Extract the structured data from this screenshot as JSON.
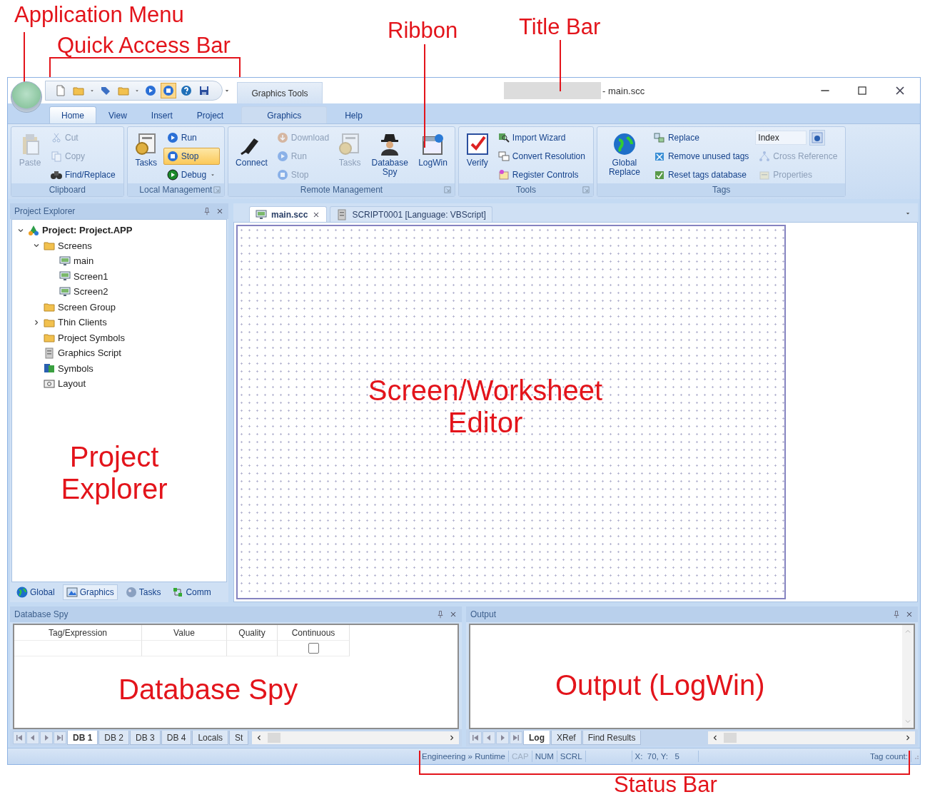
{
  "annotations": [
    "Application Menu",
    "Quick Access Bar",
    "Ribbon",
    "Title Bar",
    "Screen/Worksheet Editor",
    "Project Explorer",
    "Database Spy",
    "Output (LogWin)",
    "Status Bar"
  ],
  "quick_access_bar": {
    "items": [
      {
        "pressed": false
      },
      {
        "pressed": false
      },
      {
        "pressed": false
      },
      {
        "pressed": false
      },
      {
        "pressed": false
      },
      {
        "pressed": true
      },
      {
        "pressed": false
      },
      {
        "pressed": false
      }
    ]
  },
  "title_bar": {
    "contextual_header": "Graphics Tools",
    "title": "- main.scc"
  },
  "ribbon": {
    "tabs": [
      {
        "label": "Home",
        "selected": true,
        "contextual": false
      },
      {
        "label": "View",
        "selected": false,
        "contextual": false
      },
      {
        "label": "Insert",
        "selected": false,
        "contextual": false
      },
      {
        "label": "Project",
        "selected": false,
        "contextual": false
      },
      {
        "label": "Graphics",
        "selected": false,
        "contextual": true
      },
      {
        "label": "Help",
        "selected": false,
        "contextual": false
      }
    ],
    "groups": [
      {
        "label": "Clipboard",
        "launcher": false,
        "columns": [
          {
            "kind": "large",
            "items": [
              {
                "label": "Paste",
                "disabled": true,
                "active": false
              }
            ]
          },
          {
            "kind": "stack",
            "items": [
              {
                "label": "Cut",
                "disabled": true,
                "active": false
              },
              {
                "label": "Copy",
                "disabled": true,
                "active": false
              },
              {
                "label": "Find/Replace",
                "disabled": false,
                "active": false
              }
            ]
          }
        ]
      },
      {
        "label": "Local Management",
        "launcher": true,
        "columns": [
          {
            "kind": "large",
            "items": [
              {
                "label": "Tasks",
                "disabled": false,
                "active": false
              }
            ]
          },
          {
            "kind": "stack",
            "items": [
              {
                "label": "Run",
                "disabled": false,
                "active": false
              },
              {
                "label": "Stop",
                "disabled": false,
                "active": true
              },
              {
                "label": "Debug",
                "disabled": false,
                "active": false,
                "dropdown": true
              }
            ]
          }
        ]
      },
      {
        "label": "Remote Management",
        "launcher": true,
        "columns": [
          {
            "kind": "large",
            "items": [
              {
                "label": "Connect",
                "disabled": false,
                "active": false
              }
            ]
          },
          {
            "kind": "stack",
            "items": [
              {
                "label": "Download",
                "disabled": true,
                "active": false
              },
              {
                "label": "Run",
                "disabled": true,
                "active": false
              },
              {
                "label": "Stop",
                "disabled": true,
                "active": false
              }
            ]
          },
          {
            "kind": "large",
            "items": [
              {
                "label": "Tasks",
                "disabled": true,
                "active": false
              }
            ]
          },
          {
            "kind": "large",
            "items": [
              {
                "label": "Database Spy",
                "disabled": false,
                "active": false
              }
            ]
          },
          {
            "kind": "large",
            "items": [
              {
                "label": "LogWin",
                "disabled": false,
                "active": false
              }
            ]
          }
        ]
      },
      {
        "label": "Tools",
        "launcher": true,
        "columns": [
          {
            "kind": "large",
            "items": [
              {
                "label": "Verify",
                "disabled": false,
                "active": false
              }
            ]
          },
          {
            "kind": "stack",
            "items": [
              {
                "label": "Import Wizard",
                "disabled": false,
                "active": false
              },
              {
                "label": "Convert Resolution",
                "disabled": false,
                "active": false
              },
              {
                "label": "Register Controls",
                "disabled": false,
                "active": false
              }
            ]
          }
        ]
      },
      {
        "label": "Tags",
        "launcher": false,
        "columns": [
          {
            "kind": "large",
            "items": [
              {
                "label": "Global Replace",
                "disabled": false,
                "active": false
              }
            ]
          },
          {
            "kind": "stack",
            "items": [
              {
                "label": "Replace",
                "disabled": false,
                "active": false
              },
              {
                "label": "Remove unused tags",
                "disabled": false,
                "active": false
              },
              {
                "label": "Reset tags database",
                "disabled": false,
                "active": false
              }
            ]
          },
          {
            "kind": "stack",
            "items": [
              {
                "kind": "field",
                "value": "Index"
              },
              {
                "kind": "button",
                "label": "Cross Reference",
                "disabled": true,
                "active": false
              },
              {
                "kind": "button",
                "label": "Properties",
                "disabled": true,
                "active": false
              }
            ]
          }
        ]
      }
    ]
  },
  "project_explorer": {
    "title": "Project Explorer",
    "tree": [
      {
        "label": "Project: Project.APP",
        "expandable": true,
        "expanded": true,
        "children": [
          {
            "label": "Screens",
            "expandable": true,
            "expanded": true,
            "children": [
              {
                "label": "main",
                "expandable": false,
                "expanded": false
              },
              {
                "label": "Screen1",
                "expandable": false,
                "expanded": false
              },
              {
                "label": "Screen2",
                "expandable": false,
                "expanded": false
              }
            ]
          },
          {
            "label": "Screen Group",
            "expandable": false,
            "expanded": false
          },
          {
            "label": "Thin Clients",
            "expandable": true,
            "expanded": false
          },
          {
            "label": "Project Symbols",
            "expandable": false,
            "expanded": false
          },
          {
            "label": "Graphics Script",
            "expandable": false,
            "expanded": false
          },
          {
            "label": "Symbols",
            "expandable": false,
            "expanded": false
          },
          {
            "label": "Layout",
            "expandable": false,
            "expanded": false
          }
        ]
      }
    ],
    "tabs": [
      {
        "label": "Global",
        "selected": false
      },
      {
        "label": "Graphics",
        "selected": true
      },
      {
        "label": "Tasks",
        "selected": false
      },
      {
        "label": "Comm",
        "selected": false
      }
    ]
  },
  "editor": {
    "tabs": [
      {
        "label": "main.scc",
        "selected": true,
        "closable": true
      },
      {
        "label": "SCRIPT0001 [Language: VBScript]",
        "selected": false,
        "closable": false
      }
    ]
  },
  "database_spy": {
    "title": "Database Spy",
    "columns": [
      "Tag/Expression",
      "Value",
      "Quality",
      "Continuous"
    ],
    "rows": [
      {
        "continuous": false
      }
    ],
    "sheets": [
      {
        "label": "DB 1",
        "selected": true
      },
      {
        "label": "DB 2",
        "selected": false
      },
      {
        "label": "DB 3",
        "selected": false
      },
      {
        "label": "DB 4",
        "selected": false
      },
      {
        "label": "Locals",
        "selected": false
      },
      {
        "label": "St",
        "selected": false
      }
    ]
  },
  "output": {
    "title": "Output",
    "sheets": [
      {
        "label": "Log",
        "selected": true
      },
      {
        "label": "XRef",
        "selected": false
      },
      {
        "label": "Find Results",
        "selected": false
      }
    ]
  },
  "status_bar": {
    "mode": "Engineering » Runtime",
    "indicators": [
      {
        "label": "CAP",
        "on": false
      },
      {
        "label": "NUM",
        "on": true
      },
      {
        "label": "SCRL",
        "on": true
      }
    ],
    "position": "X:  70, Y:   5",
    "tag_count": "Tag count:"
  }
}
